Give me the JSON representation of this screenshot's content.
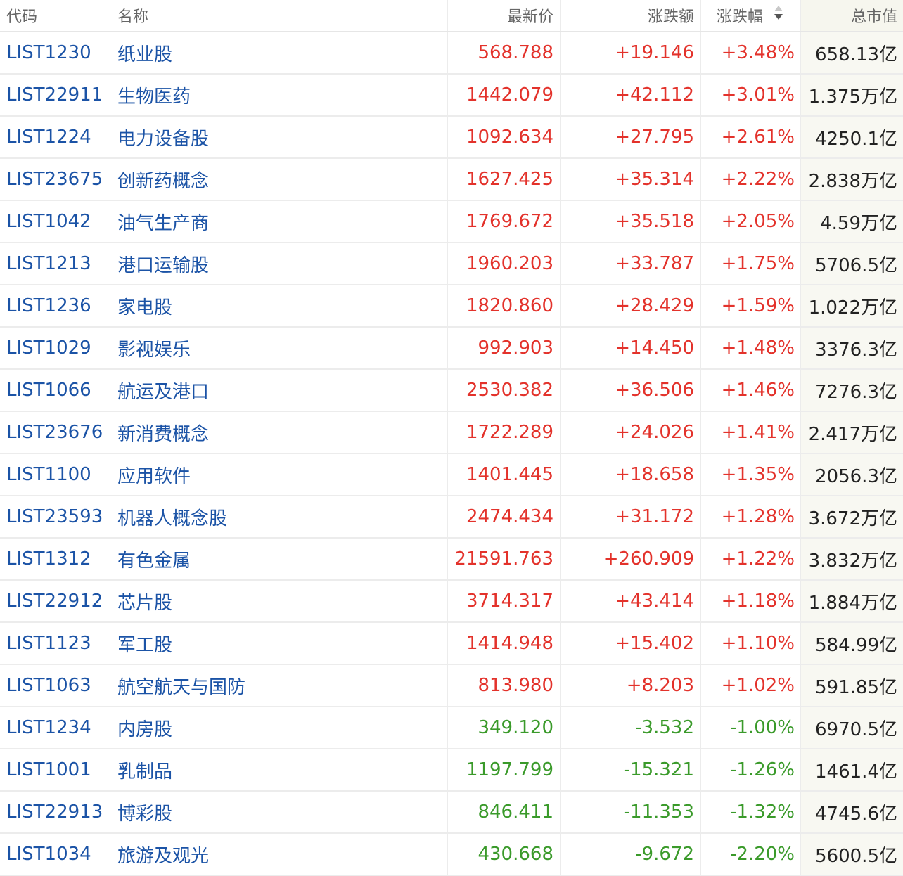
{
  "header": {
    "code": "代码",
    "name": "名称",
    "price": "最新价",
    "change": "涨跌额",
    "pct": "涨跌幅",
    "cap": "总市值"
  },
  "colors": {
    "up": "#e3322b",
    "down": "#3a9a2a",
    "link": "#1b53a6"
  },
  "rows": [
    {
      "code": "LIST1230",
      "name": "纸业股",
      "price": "568.788",
      "change": "+19.146",
      "pct": "+3.48%",
      "cap": "658.13亿",
      "dir": "up"
    },
    {
      "code": "LIST22911",
      "name": "生物医药",
      "price": "1442.079",
      "change": "+42.112",
      "pct": "+3.01%",
      "cap": "1.375万亿",
      "dir": "up"
    },
    {
      "code": "LIST1224",
      "name": "电力设备股",
      "price": "1092.634",
      "change": "+27.795",
      "pct": "+2.61%",
      "cap": "4250.1亿",
      "dir": "up"
    },
    {
      "code": "LIST23675",
      "name": "创新药概念",
      "price": "1627.425",
      "change": "+35.314",
      "pct": "+2.22%",
      "cap": "2.838万亿",
      "dir": "up"
    },
    {
      "code": "LIST1042",
      "name": "油气生产商",
      "price": "1769.672",
      "change": "+35.518",
      "pct": "+2.05%",
      "cap": "4.59万亿",
      "dir": "up"
    },
    {
      "code": "LIST1213",
      "name": "港口运输股",
      "price": "1960.203",
      "change": "+33.787",
      "pct": "+1.75%",
      "cap": "5706.5亿",
      "dir": "up"
    },
    {
      "code": "LIST1236",
      "name": "家电股",
      "price": "1820.860",
      "change": "+28.429",
      "pct": "+1.59%",
      "cap": "1.022万亿",
      "dir": "up"
    },
    {
      "code": "LIST1029",
      "name": "影视娱乐",
      "price": "992.903",
      "change": "+14.450",
      "pct": "+1.48%",
      "cap": "3376.3亿",
      "dir": "up"
    },
    {
      "code": "LIST1066",
      "name": "航运及港口",
      "price": "2530.382",
      "change": "+36.506",
      "pct": "+1.46%",
      "cap": "7276.3亿",
      "dir": "up"
    },
    {
      "code": "LIST23676",
      "name": "新消费概念",
      "price": "1722.289",
      "change": "+24.026",
      "pct": "+1.41%",
      "cap": "2.417万亿",
      "dir": "up"
    },
    {
      "code": "LIST1100",
      "name": "应用软件",
      "price": "1401.445",
      "change": "+18.658",
      "pct": "+1.35%",
      "cap": "2056.3亿",
      "dir": "up"
    },
    {
      "code": "LIST23593",
      "name": "机器人概念股",
      "price": "2474.434",
      "change": "+31.172",
      "pct": "+1.28%",
      "cap": "3.672万亿",
      "dir": "up"
    },
    {
      "code": "LIST1312",
      "name": "有色金属",
      "price": "21591.763",
      "change": "+260.909",
      "pct": "+1.22%",
      "cap": "3.832万亿",
      "dir": "up"
    },
    {
      "code": "LIST22912",
      "name": "芯片股",
      "price": "3714.317",
      "change": "+43.414",
      "pct": "+1.18%",
      "cap": "1.884万亿",
      "dir": "up"
    },
    {
      "code": "LIST1123",
      "name": "军工股",
      "price": "1414.948",
      "change": "+15.402",
      "pct": "+1.10%",
      "cap": "584.99亿",
      "dir": "up"
    },
    {
      "code": "LIST1063",
      "name": "航空航天与国防",
      "price": "813.980",
      "change": "+8.203",
      "pct": "+1.02%",
      "cap": "591.85亿",
      "dir": "up"
    },
    {
      "code": "LIST1234",
      "name": "内房股",
      "price": "349.120",
      "change": "-3.532",
      "pct": "-1.00%",
      "cap": "6970.5亿",
      "dir": "down"
    },
    {
      "code": "LIST1001",
      "name": "乳制品",
      "price": "1197.799",
      "change": "-15.321",
      "pct": "-1.26%",
      "cap": "1461.4亿",
      "dir": "down"
    },
    {
      "code": "LIST22913",
      "name": "博彩股",
      "price": "846.411",
      "change": "-11.353",
      "pct": "-1.32%",
      "cap": "4745.6亿",
      "dir": "down"
    },
    {
      "code": "LIST1034",
      "name": "旅游及观光",
      "price": "430.668",
      "change": "-9.672",
      "pct": "-2.20%",
      "cap": "5600.5亿",
      "dir": "down"
    }
  ]
}
